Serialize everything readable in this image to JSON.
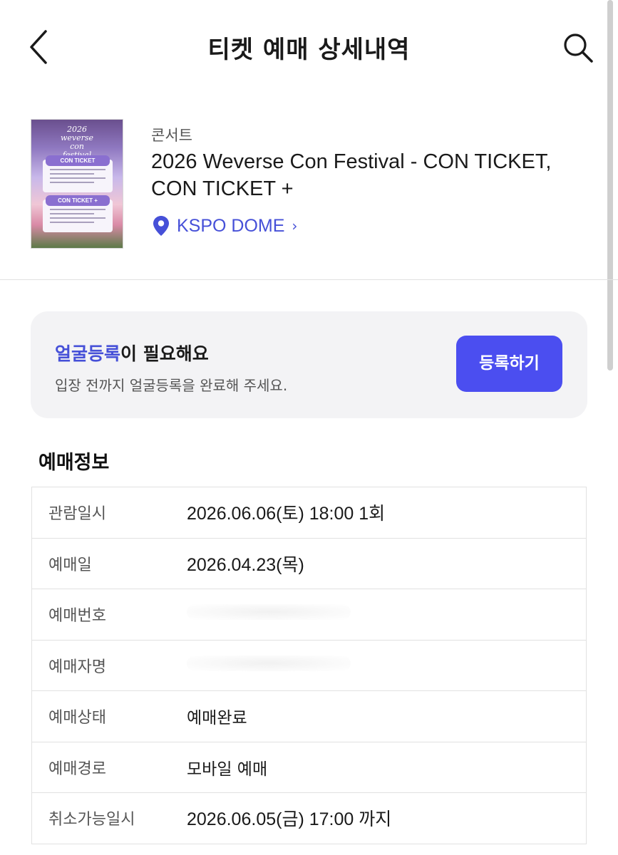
{
  "header": {
    "title": "티켓 예매 상세내역",
    "back_icon": "chevron-left-icon",
    "search_icon": "search-icon"
  },
  "event": {
    "category": "콘서트",
    "title": "2026 Weverse Con Festival - CON TICKET, CON TICKET +",
    "venue": "KSPO DOME",
    "venue_icon": "map-pin-icon",
    "poster": {
      "year": "2026",
      "brand": "weverse",
      "line2": "con",
      "line3": "festival",
      "badge1": "CON TICKET",
      "badge2": "CON TICKET +"
    }
  },
  "notice": {
    "title_highlight": "얼굴등록",
    "title_rest": "이 필요해요",
    "description": "입장 전까지 얼굴등록을 완료해 주세요.",
    "button_label": "등록하기"
  },
  "booking": {
    "section_title": "예매정보",
    "rows": [
      {
        "label": "관람일시",
        "value": "2026.06.06(토) 18:00 1회"
      },
      {
        "label": "예매일",
        "value": "2026.04.23(목)"
      },
      {
        "label": "예매번호",
        "value": ""
      },
      {
        "label": "예매자명",
        "value": ""
      },
      {
        "label": "예매상태",
        "value": "예매완료"
      },
      {
        "label": "예매경로",
        "value": "모바일 예매"
      },
      {
        "label": "취소가능일시",
        "value": "2026.06.05(금) 17:00 까지"
      }
    ]
  },
  "colors": {
    "accent": "#4650d8",
    "button": "#4b4ef0",
    "banner_bg": "#f3f3f5"
  }
}
